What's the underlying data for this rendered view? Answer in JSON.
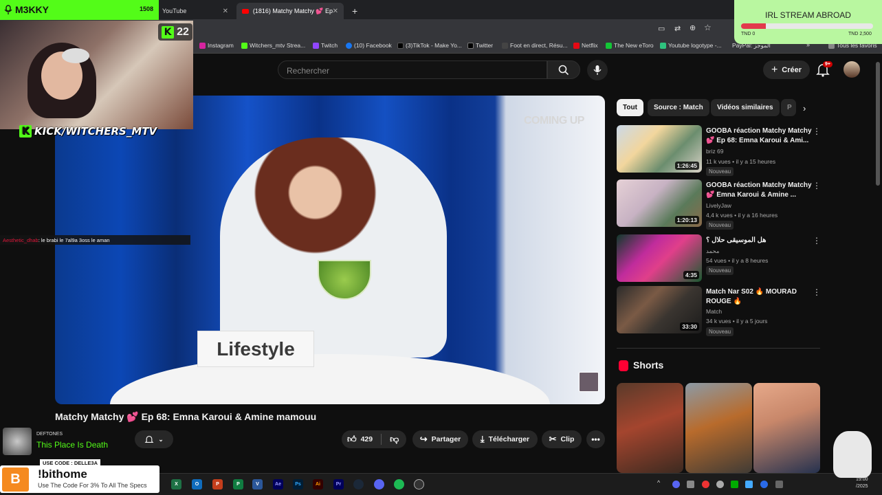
{
  "stream_overlay": {
    "streamer_name": "M3KKY",
    "viewer_count": "1508",
    "kick_follower_count": "22",
    "kick_logo": "K",
    "kick_handle": "KICK/WITCHERS_MTV",
    "chat": {
      "user": "Aesthetic_dhab",
      "message": ": le brabi le 7al9a 3oss le aman"
    },
    "goal": {
      "title": "IRL STREAM ABROAD",
      "min_label": "TND 0",
      "max_label": "TND 2,500",
      "progress_percent": 19
    },
    "music": {
      "artist": "DEFTONES",
      "track": "This Place Is Death"
    },
    "promo": {
      "code": "USE CODE : DELLE3A",
      "logo": "B",
      "command": "!bithome",
      "text": "Use The Code For 3% To All The Specs"
    }
  },
  "browser": {
    "tabs": [
      {
        "label": "YouTube",
        "active": false
      },
      {
        "label": "(1816) Matchy Matchy 💕 Ep 6",
        "active": true
      }
    ],
    "bookmarks": [
      "Instagram",
      "Witchers_mtv Strea...",
      "Twitch",
      "(10) Facebook",
      "(3)TikTok - Make Yo...",
      "Twitter",
      "Foot en direct, Résu...",
      "Netflix",
      "The New eToro",
      "Youtube logotype -...",
      "PayPal: الموجز",
      "Tous les favoris"
    ]
  },
  "youtube": {
    "search_placeholder": "Rechercher",
    "create_label": "Créer",
    "notification_badge": "9+",
    "video": {
      "title": "Matchy Matchy 💕 Ep 68: Emna Karoui & Amine mamouu",
      "overlay_text": "COMING UP",
      "card_text": "Lifestyle",
      "likes": "429",
      "share_label": "Partager",
      "download_label": "Télécharger",
      "clip_label": "Clip"
    },
    "chips": [
      "Tout",
      "Source : Match",
      "Vidéos similaires",
      "P"
    ],
    "recommendations": [
      {
        "title": "GOOBA réaction Matchy Matchy 💕 Ep 68: Emna Karoui & Ami...",
        "channel": "briz 69",
        "meta": "11 k vues  •  il y a 15 heures",
        "badge": "Nouveau",
        "duration": "1:26:45"
      },
      {
        "title": "GOOBA réaction Matchy Matchy 💕 Emna Karoui & Amine ...",
        "channel": "LivelyJaw",
        "meta": "4,4 k vues  •  il y a 16 heures",
        "badge": "Nouveau",
        "duration": "1:20:13"
      },
      {
        "title": "هل الموسيقى حلال ؟",
        "channel": "محمد",
        "meta": "54 vues  •  il y a 8 heures",
        "badge": "Nouveau",
        "duration": "4:35"
      },
      {
        "title": "Match Nar S02 🔥 MOURAD ROUGE 🔥",
        "channel": "Match",
        "meta": "34 k vues  •  il y a 5 jours",
        "badge": "Nouveau",
        "duration": "33:30"
      }
    ],
    "shorts_title": "Shorts"
  },
  "taskbar": {
    "apps": [
      "X",
      "O",
      "P",
      "P",
      "V",
      "Ae",
      "Ps",
      "Ai",
      "Pr"
    ],
    "clock": {
      "time": "19:00",
      "date": "/2025"
    }
  },
  "colors": {
    "kick_green": "#53fc18",
    "youtube_red": "#ff0000",
    "goal_fill": "#e23a4c"
  }
}
